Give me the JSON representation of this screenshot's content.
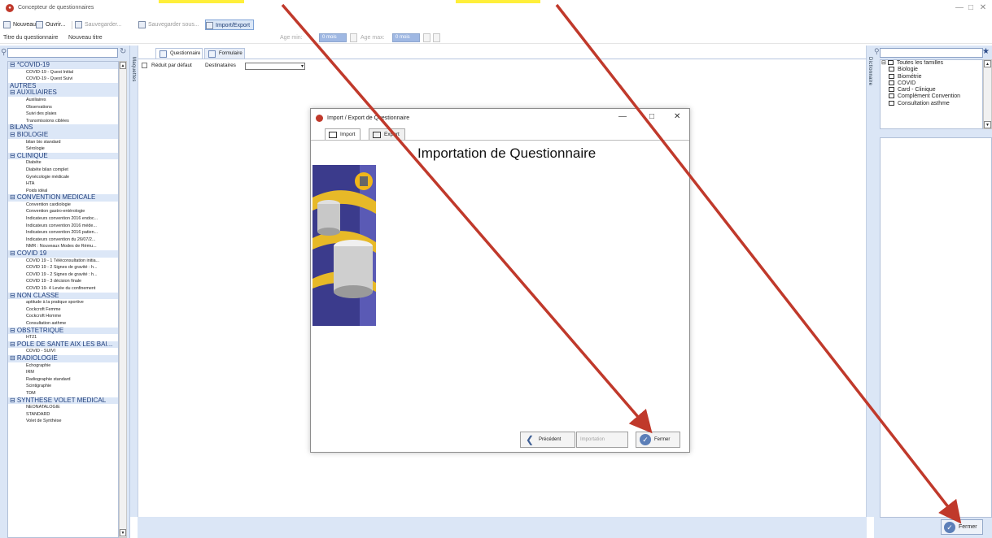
{
  "window": {
    "title": "Concepteur de questionnaires",
    "min": "—",
    "max": "□",
    "close": "✕"
  },
  "toolbar": {
    "new_label": "Nouveau",
    "open_label": "Ouvrir...",
    "save_label": "Sauvegarder...",
    "saveas_label": "Sauvegarder sous...",
    "import_export_label": "Import/Export"
  },
  "subbar": {
    "title_label": "Titre du questionnaire",
    "title_value": "Nouveau titre",
    "age_min_label": "Age min:",
    "age_min_value": "0 mois",
    "age_max_label": "Age max:",
    "age_max_value": "0 mois"
  },
  "left": {
    "vertical_label": "Maquettes",
    "categories": [
      {
        "label": "⊟ *COVID-19",
        "items": [
          "COVID-19 - Quest Initial",
          "COVID-19 - Quest Suivi"
        ]
      },
      {
        "label": "AUTRES",
        "items": []
      },
      {
        "label": "⊟ AUXILIAIRES",
        "items": [
          "Auxiliaires",
          "Observations",
          "Suivi des plaies",
          "Transmissions ciblées"
        ]
      },
      {
        "label": "BILANS",
        "items": []
      },
      {
        "label": "⊟ BIOLOGIE",
        "items": [
          "bilan bio standard",
          "Sérologie"
        ]
      },
      {
        "label": "⊟ CLINIQUE",
        "items": [
          "Diabète",
          "Diabète bilan complet",
          "Gynécologie médicale",
          "HTA",
          "Poids idéal"
        ]
      },
      {
        "label": "⊟ CONVENTION MEDICALE",
        "items": [
          "Convention cardiologie",
          "Convention gastro-entérologie",
          "Indicateurs convention 2016 endoc...",
          "Indicateurs convention 2016 méde...",
          "Indicateurs convention 2016 patien...",
          "Indicateurs convention du 26/07/2...",
          "NMR : Nouveaux Modes de Rému..."
        ]
      },
      {
        "label": "⊟ COVID 19",
        "items": [
          "COVID 19 - 1 Téléconsultation initia...",
          "COVID 19 - 2 Signes de gravité : h...",
          "COVID 19 - 2 Signes de gravité : h...",
          "COVID 19 - 3 décision finale",
          "COVID 19- 4 Levée du confinement"
        ]
      },
      {
        "label": "⊟ NON CLASSE",
        "items": [
          "aptitude à la pratique sportive",
          "Cockcroft Femme",
          "Cockcroft Homme",
          "Consultation asthme"
        ]
      },
      {
        "label": "⊟ OBSTETRIQUE",
        "items": [
          "HT21"
        ]
      },
      {
        "label": "⊟ POLE DE SANTÉ AIX LES BAI...",
        "items": [
          "COVID - SUIVI"
        ]
      },
      {
        "label": "⊟ RADIOLOGIE",
        "items": [
          "Echographie",
          "IRM",
          "Radiographie standard",
          "Scintigraphie",
          "TDM"
        ]
      },
      {
        "label": "⊟ SYNTHESE VOLET MEDICAL",
        "items": [
          "NEONATALOGIE",
          "STANDARD",
          "Volet de Synthèse"
        ]
      }
    ]
  },
  "center": {
    "tabs": [
      "Questionnaire",
      "Formulaire"
    ],
    "reduced_label": "Réduit par défaut",
    "recipients_label": "Destinataires"
  },
  "right": {
    "vertical_label": "Dictionnaire",
    "root": "Toutes les familles",
    "items": [
      "Biologie",
      "Biométrie",
      "COVID",
      "Card - Clinique",
      "Complément Convention",
      "Consultation asthme"
    ]
  },
  "footer": {
    "close_label": "Fermer"
  },
  "dialog": {
    "title": "Import / Export de Questionnaire",
    "tabs": [
      "Import",
      "Export"
    ],
    "heading": "Importation de Questionnaire",
    "prev_label": "Précédent",
    "import_label": "Importation",
    "close_label": "Fermer"
  },
  "colors": {
    "accent": "#5c7fb8",
    "arrow": "#c0392b",
    "highlight": "#ffef3a",
    "panel": "#dbe6f6"
  }
}
